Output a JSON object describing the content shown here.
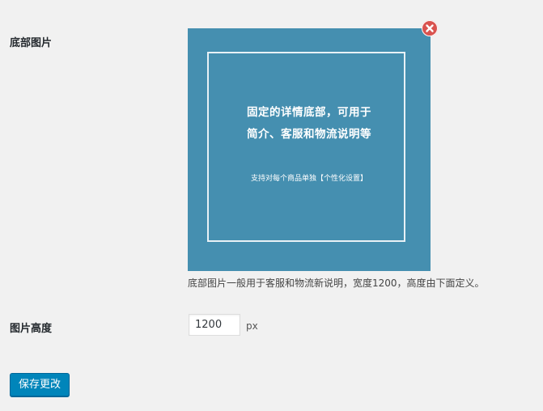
{
  "footer_image": {
    "label": "底部图片",
    "preview": {
      "headline_line1": "固定的详情底部，可用于",
      "headline_line2": "简介、客服和物流说明等",
      "subline": "支持对每个商品单独【个性化设置】",
      "background_color": "#458fb0"
    },
    "remove_icon": "close-circle-icon",
    "description": "底部图片一般用于客服和物流新说明，宽度1200，高度由下面定义。"
  },
  "image_height": {
    "label": "图片高度",
    "value": "1200",
    "unit": "px"
  },
  "actions": {
    "save_label": "保存更改"
  },
  "colors": {
    "primary_button": "#0085ba",
    "remove_button": "#d9534f",
    "page_background": "#f1f1f1"
  }
}
